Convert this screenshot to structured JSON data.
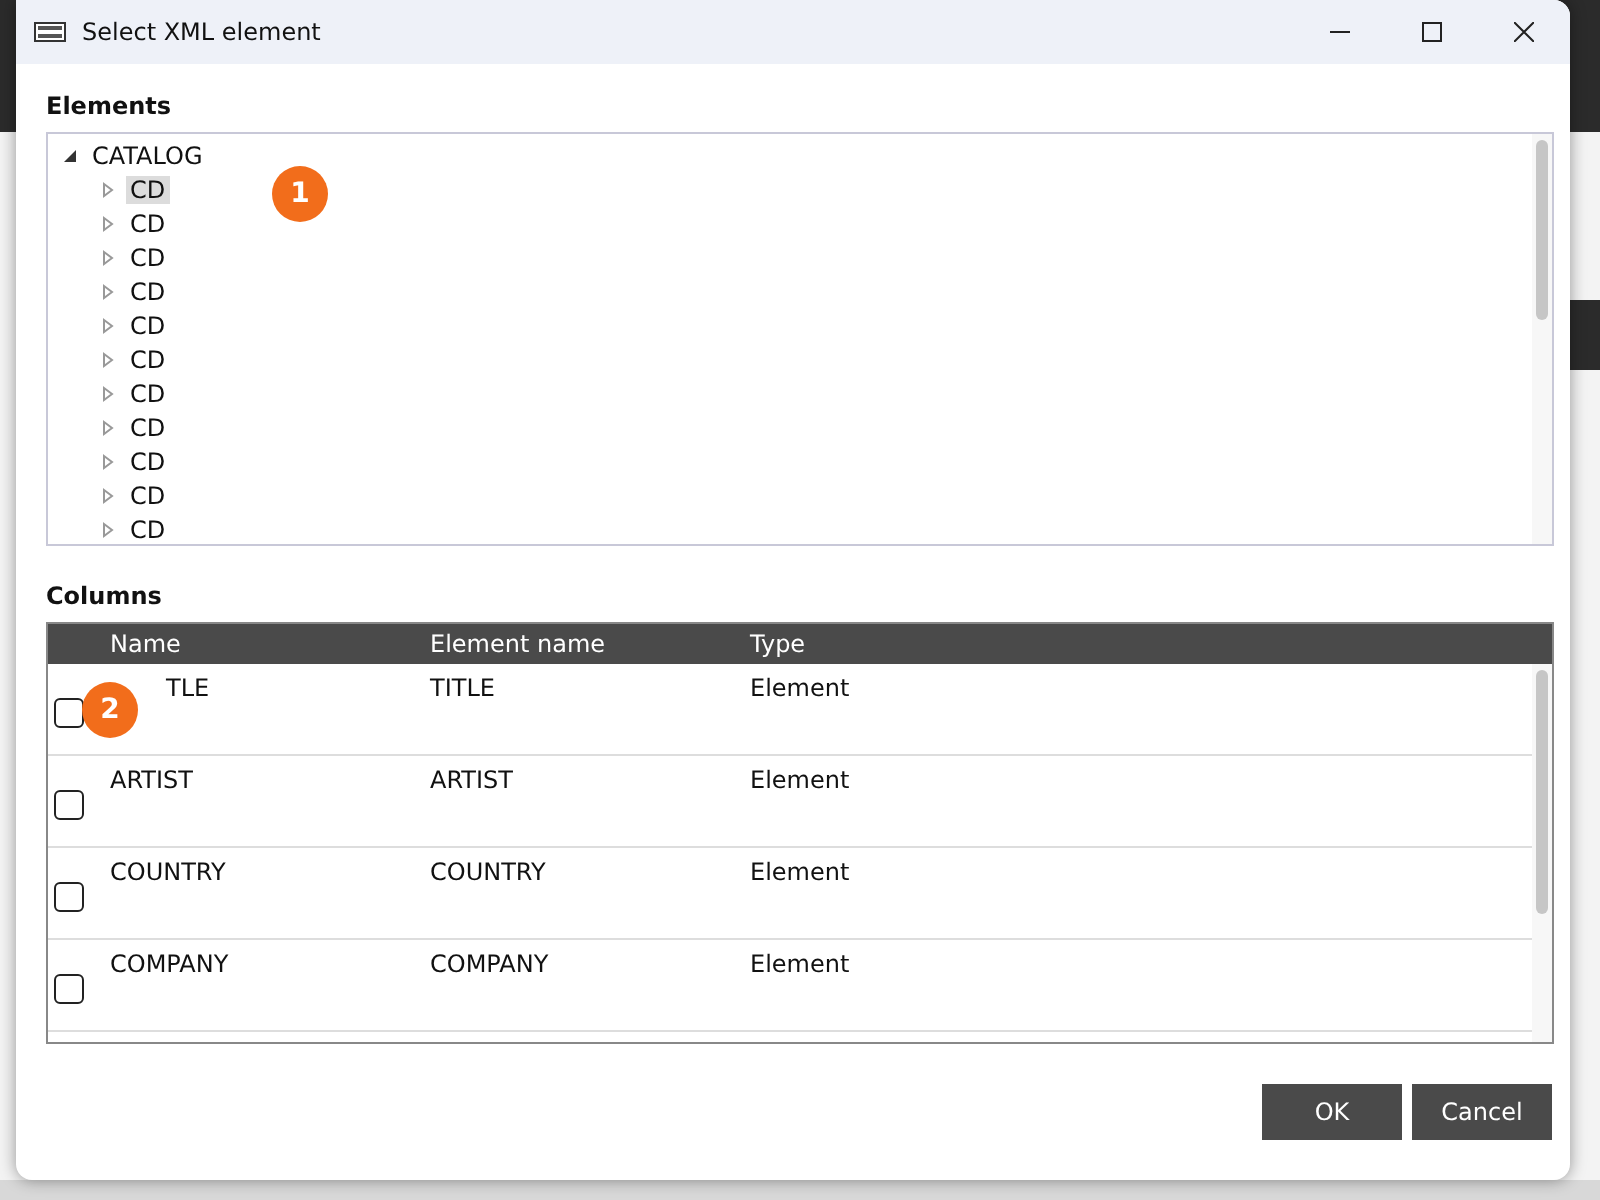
{
  "window": {
    "title": "Select XML element"
  },
  "elements": {
    "label": "Elements",
    "tree": [
      {
        "label": "CATALOG",
        "expanded": true,
        "selected": false,
        "children": [
          {
            "label": "CD",
            "expanded": false,
            "selected": true
          },
          {
            "label": "CD",
            "expanded": false,
            "selected": false
          },
          {
            "label": "CD",
            "expanded": false,
            "selected": false
          },
          {
            "label": "CD",
            "expanded": false,
            "selected": false
          },
          {
            "label": "CD",
            "expanded": false,
            "selected": false
          },
          {
            "label": "CD",
            "expanded": false,
            "selected": false
          },
          {
            "label": "CD",
            "expanded": false,
            "selected": false
          },
          {
            "label": "CD",
            "expanded": false,
            "selected": false
          },
          {
            "label": "CD",
            "expanded": false,
            "selected": false
          },
          {
            "label": "CD",
            "expanded": false,
            "selected": false
          },
          {
            "label": "CD",
            "expanded": false,
            "selected": false
          }
        ]
      }
    ]
  },
  "columns": {
    "label": "Columns",
    "headers": [
      "Name",
      "Element name",
      "Type"
    ],
    "rows": [
      {
        "checked": false,
        "cells": [
          "TLE",
          "TITLE",
          "Element"
        ]
      },
      {
        "checked": false,
        "cells": [
          "ARTIST",
          "ARTIST",
          "Element"
        ]
      },
      {
        "checked": false,
        "cells": [
          "COUNTRY",
          "COUNTRY",
          "Element"
        ]
      },
      {
        "checked": false,
        "cells": [
          "COMPANY",
          "COMPANY",
          "Element"
        ]
      }
    ]
  },
  "callouts": [
    "1",
    "2"
  ],
  "buttons": [
    "OK",
    "Cancel"
  ]
}
